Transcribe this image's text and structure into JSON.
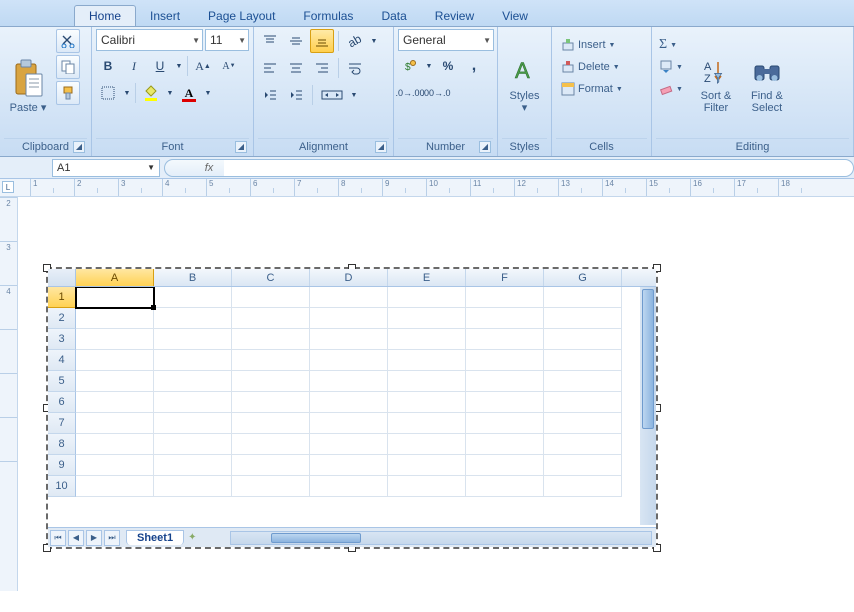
{
  "tabs": [
    "Home",
    "Insert",
    "Page Layout",
    "Formulas",
    "Data",
    "Review",
    "View"
  ],
  "activeTab": "Home",
  "font": {
    "name": "Calibri",
    "size": "11"
  },
  "numberFormat": "General",
  "groups": {
    "clipboard": "Clipboard",
    "font": "Font",
    "alignment": "Alignment",
    "number": "Number",
    "styles": "Styles",
    "cells": "Cells",
    "editing": "Editing"
  },
  "buttons": {
    "paste": "Paste",
    "styles": "Styles",
    "insert": "Insert",
    "delete": "Delete",
    "format": "Format",
    "sortFilter": "Sort &\nFilter",
    "findSelect": "Find &\nSelect"
  },
  "nameBox": "A1",
  "fx": "fx",
  "ruler": {
    "start": 1,
    "end": 18,
    "vstart": 2,
    "vend": 4
  },
  "columns": [
    "A",
    "B",
    "C",
    "D",
    "E",
    "F",
    "G"
  ],
  "rowCount": 10,
  "activeCell": {
    "row": 1,
    "col": "A"
  },
  "sheetTab": "Sheet1"
}
